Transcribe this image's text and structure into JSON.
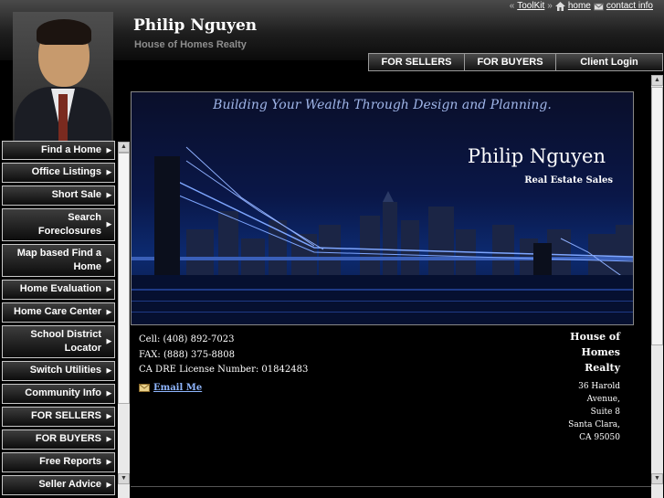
{
  "header": {
    "name": "Philip Nguyen",
    "company": "House of Homes Realty",
    "utility": {
      "toolkit": "ToolKit",
      "home": "home",
      "contact": "contact info"
    },
    "top_nav": [
      "FOR SELLERS",
      "FOR BUYERS",
      "Client Login"
    ]
  },
  "sidebar": {
    "items": [
      {
        "label": "Find a Home"
      },
      {
        "label": "Office Listings"
      },
      {
        "label": "Short Sale"
      },
      {
        "label": "Search Foreclosures"
      },
      {
        "label": "Map based Find a Home"
      },
      {
        "label": "Home Evaluation"
      },
      {
        "label": "Home Care Center"
      },
      {
        "label": "School District Locator"
      },
      {
        "label": "Switch Utilities"
      },
      {
        "label": "Community Info"
      },
      {
        "label": "FOR SELLERS"
      },
      {
        "label": "FOR BUYERS"
      },
      {
        "label": "Free Reports"
      },
      {
        "label": "Seller Advice"
      }
    ]
  },
  "banner": {
    "tagline": "Building Your Wealth Through Design and Planning.",
    "name": "Philip Nguyen",
    "subtitle": "Real Estate Sales"
  },
  "contact": {
    "cell": "Cell: (408) 892-7023",
    "fax": "FAX: (888) 375-8808",
    "license": "CA DRE License Number: 01842483",
    "email_label": "Email Me"
  },
  "office": {
    "name": "House of Homes Realty",
    "address": "36 Harold Avenue, Suite 8 Santa Clara, CA 95050"
  },
  "icons": {
    "home": "home-icon",
    "contact": "envelope-icon",
    "email": "mail-icon",
    "sidebar_arrow": "triangle-right-icon"
  },
  "colors": {
    "link": "#8fb6ff",
    "tagline": "#9fb5e8"
  }
}
